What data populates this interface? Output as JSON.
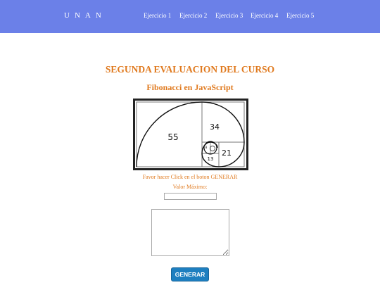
{
  "navbar": {
    "brand": "UNAN",
    "links": [
      "Ejercicio 1",
      "Ejercicio 2",
      "Ejercicio 3",
      "Ejercicio 4",
      "Ejercicio 5"
    ]
  },
  "main": {
    "title": "SEGUNDA EVALUACION DEL CURSO",
    "subtitle": "Fibonacci en JavaScript",
    "image_numbers": [
      "55",
      "34",
      "21",
      "13",
      "8"
    ],
    "instruction": "Favor hacer Click en el boton GENERAR",
    "max_label": "Valor Máximo:",
    "max_value": "",
    "output_value": "",
    "generate_label": "GENERAR"
  },
  "colors": {
    "navbar": "#6b80e8",
    "accent": "#e07a1f",
    "button": "#1e7fc0"
  }
}
